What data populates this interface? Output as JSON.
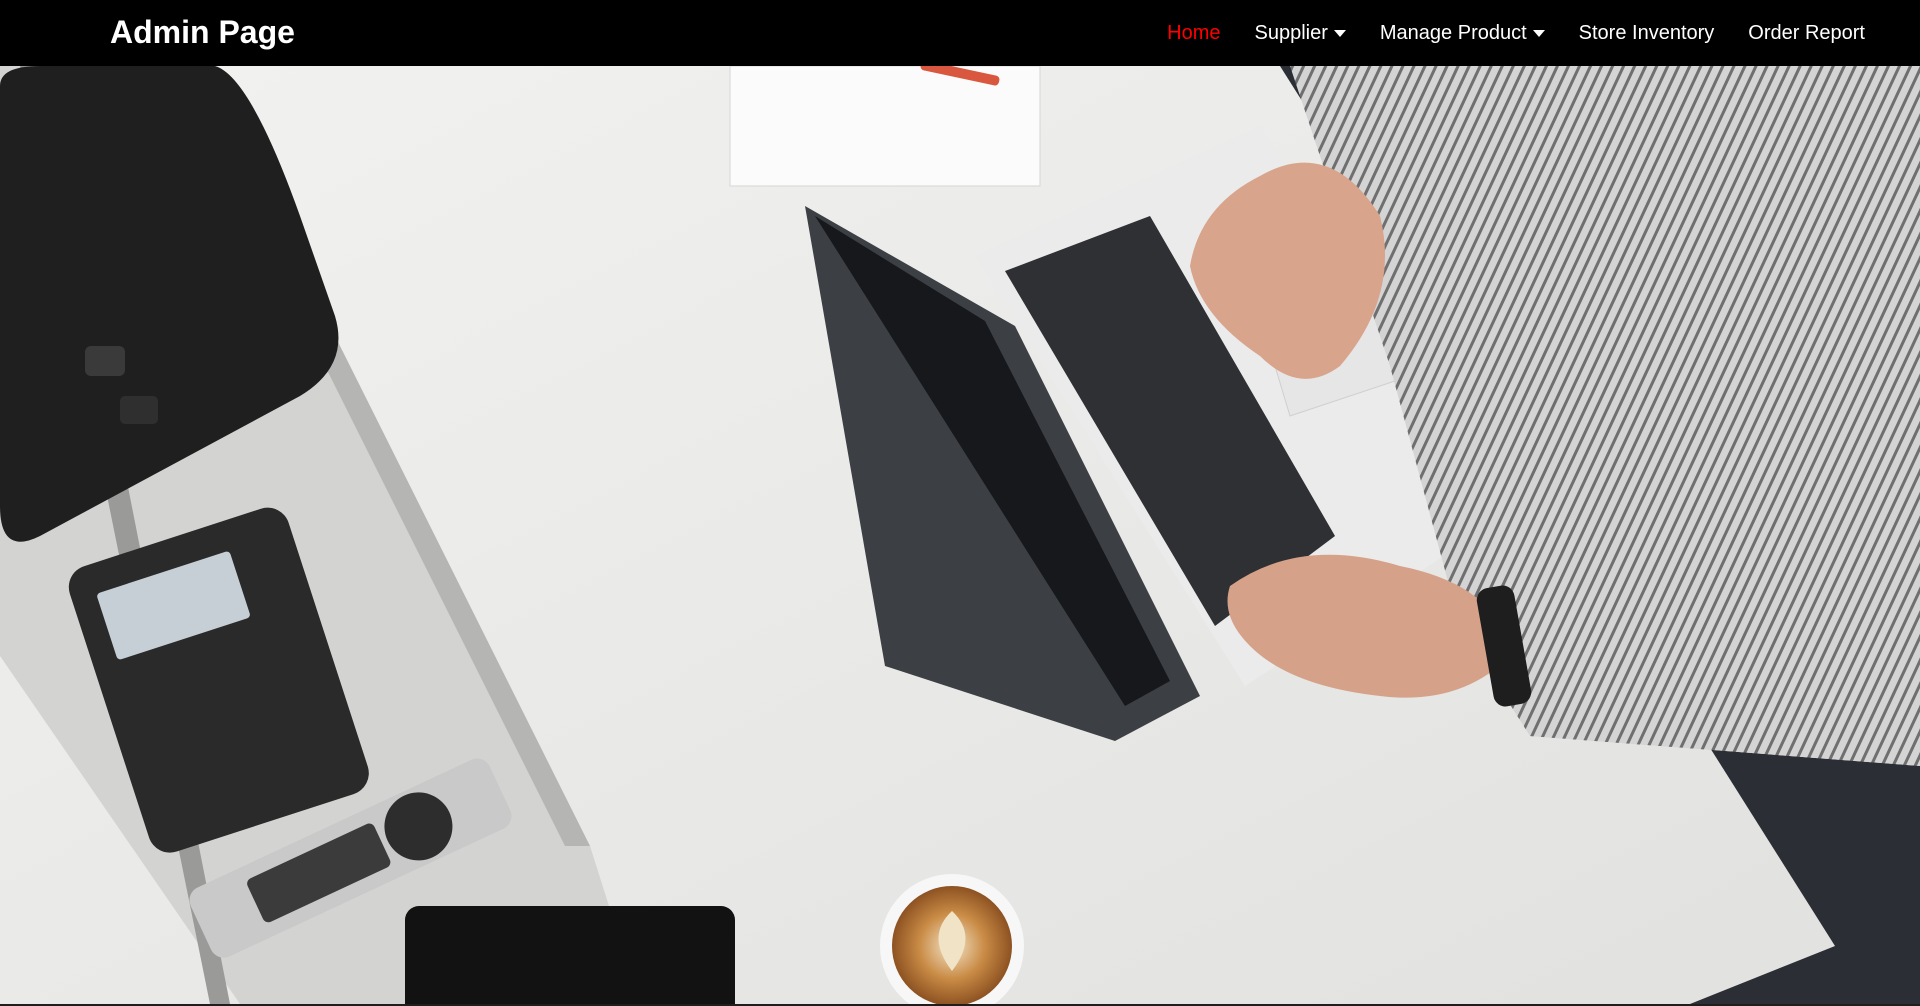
{
  "navbar": {
    "brand": "Admin Page",
    "items": [
      {
        "label": "Home",
        "active": true,
        "dropdown": false
      },
      {
        "label": "Supplier",
        "active": false,
        "dropdown": true
      },
      {
        "label": "Manage Product",
        "active": false,
        "dropdown": true
      },
      {
        "label": "Store Inventory",
        "active": false,
        "dropdown": false
      },
      {
        "label": "Order Report",
        "active": false,
        "dropdown": false
      }
    ],
    "colors": {
      "background": "#000000",
      "text": "#ffffff",
      "active": "#ff0000"
    }
  },
  "hero": {
    "image": "top-down-office-desk-laptop-typing-photo",
    "icons": [
      "conference-phone-icon",
      "desk-phone-icon",
      "remote-control-icon",
      "laptop-icon",
      "coffee-cup-icon",
      "notepad-icon",
      "pen-icon",
      "tablet-icon"
    ]
  }
}
